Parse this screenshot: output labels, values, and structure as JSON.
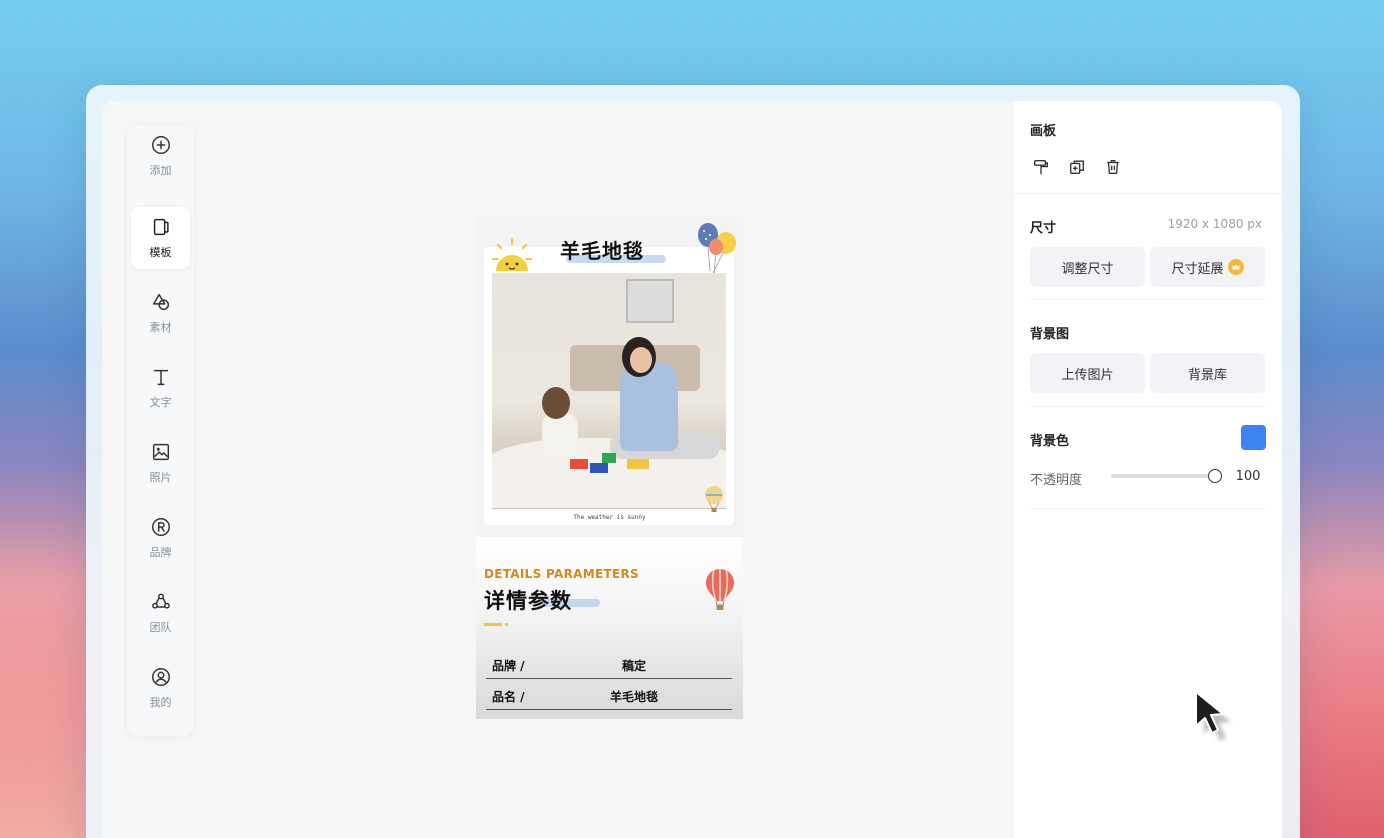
{
  "sidebar": {
    "items": [
      {
        "label": "添加",
        "icon": "plus-circle-icon"
      },
      {
        "label": "模板",
        "icon": "template-icon",
        "active": true
      },
      {
        "label": "素材",
        "icon": "shapes-icon"
      },
      {
        "label": "文字",
        "icon": "text-icon"
      },
      {
        "label": "照片",
        "icon": "image-icon"
      },
      {
        "label": "品牌",
        "icon": "registered-icon"
      },
      {
        "label": "团队",
        "icon": "team-icon"
      },
      {
        "label": "我的",
        "icon": "user-icon"
      }
    ]
  },
  "poster": {
    "title": "羊毛地毯",
    "caption": "The weather is sunny",
    "details_en": "DETAILS PARAMETERS",
    "details_cn": "详情参数",
    "params": [
      {
        "key": "品牌 /",
        "value": "稿定"
      },
      {
        "key": "品名 /",
        "value": "羊毛地毯"
      }
    ]
  },
  "panel": {
    "title": "画板",
    "size": {
      "label": "尺寸",
      "value": "1920 x 1080 px",
      "resize_button": "调整尺寸",
      "extend_button": "尺寸延展"
    },
    "background_image": {
      "label": "背景图",
      "upload_button": "上传图片",
      "library_button": "背景库"
    },
    "background_color": {
      "label": "背景色",
      "color": "#3d83f5"
    },
    "opacity": {
      "label": "不透明度",
      "value": "100",
      "fraction": 1.0
    }
  }
}
